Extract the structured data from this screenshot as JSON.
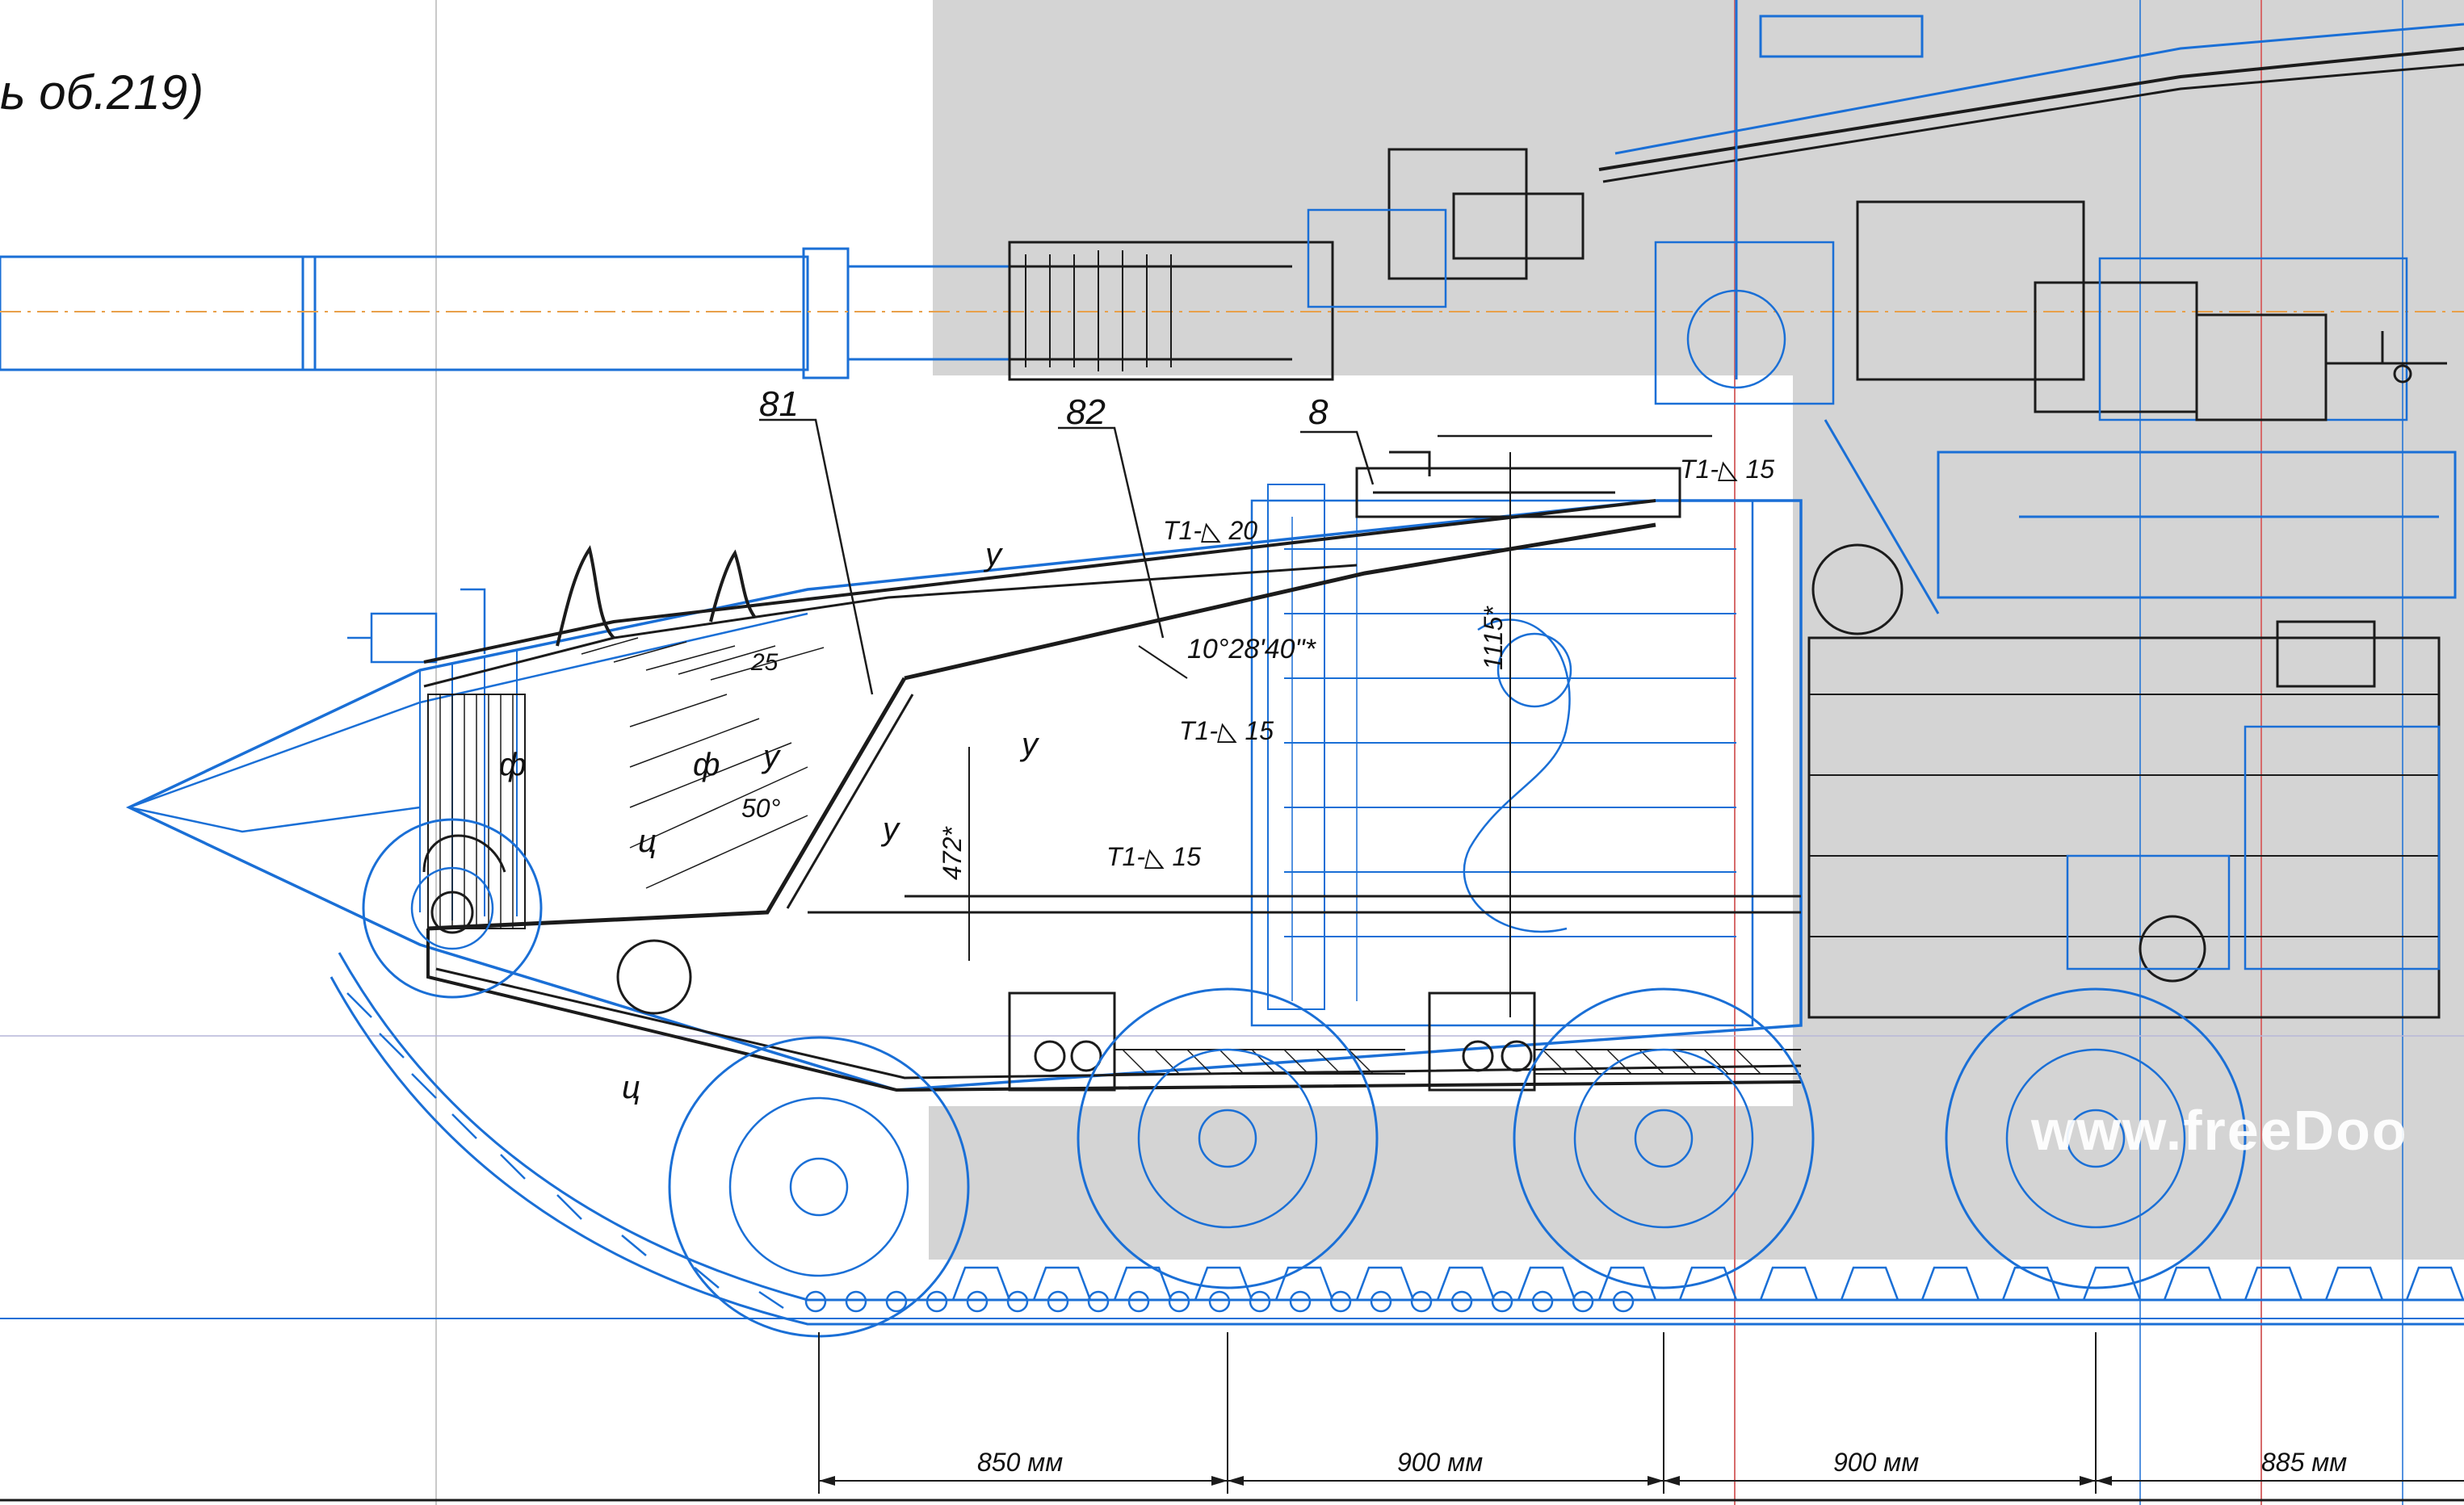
{
  "drawing": {
    "caption": "ь об.219)",
    "callouts": [
      {
        "id": "81",
        "text": "81"
      },
      {
        "id": "82",
        "text": "82"
      },
      {
        "id": "8",
        "text": "8"
      }
    ],
    "weld_marks": [
      "T1-◺ 15",
      "T1-◺ 20",
      "T1-◺ 15",
      "T1-◺ 15"
    ],
    "angle_label": "10°28'40\"*",
    "slope_angle": "50°",
    "plate_thickness": "25",
    "height_dims": [
      "1115*",
      "472*"
    ],
    "section_letters": [
      "ф",
      "ф",
      "у",
      "у",
      "у",
      "у",
      "ц",
      "ц"
    ],
    "spacing_dims": [
      "850 мм",
      "900 мм",
      "900 мм",
      "885 мм"
    ],
    "watermark": "www.freeDoo"
  },
  "colors": {
    "blueprint_blue": "#1a6fd6",
    "ink": "#1b1b1b",
    "scan_gray": "#d4d4d4",
    "axis_orange": "#e8a04a",
    "red_guide": "#d66a6a"
  }
}
